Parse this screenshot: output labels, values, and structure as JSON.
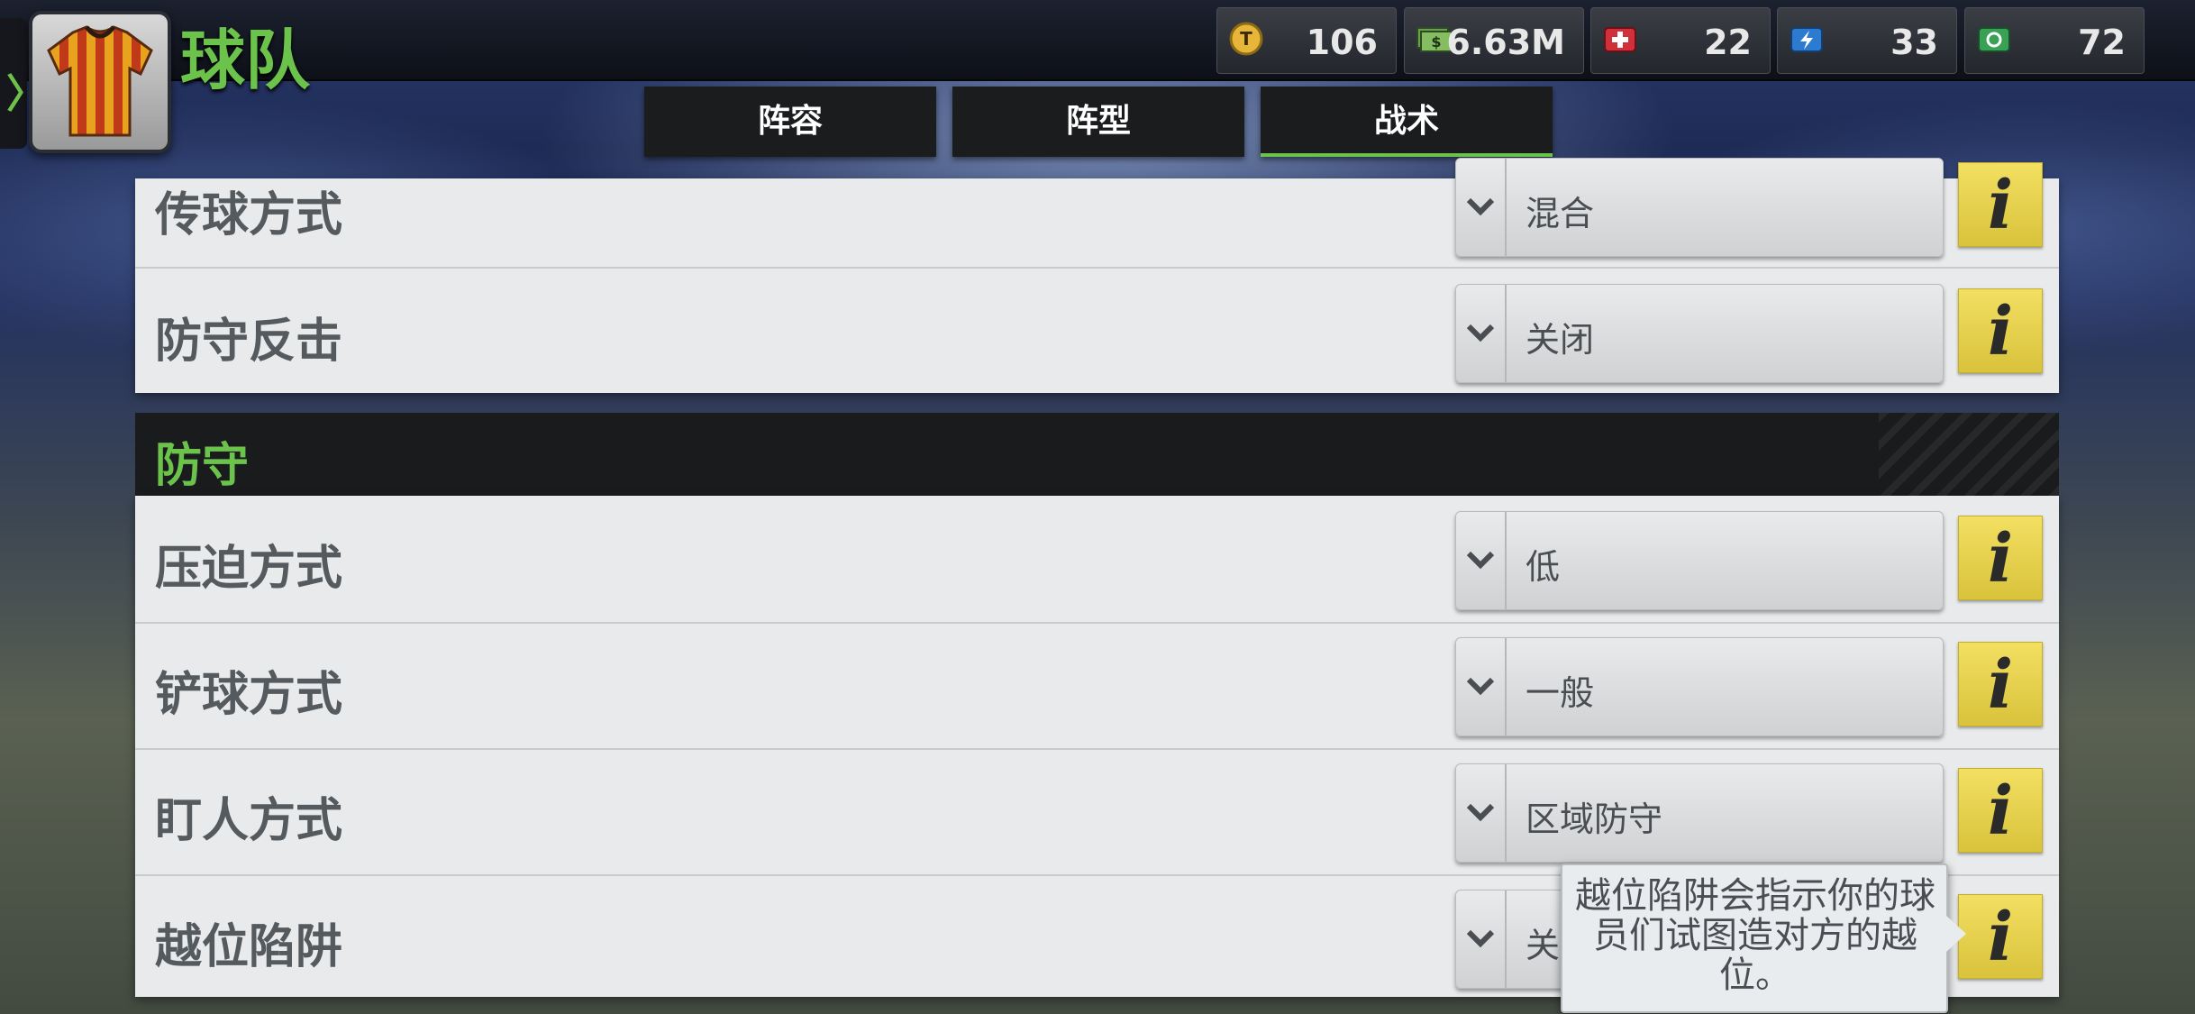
{
  "header": {
    "title": "球队"
  },
  "currencies": [
    {
      "icon": "token-coin-icon",
      "value": "106"
    },
    {
      "icon": "cash-icon",
      "value": "6.63M"
    },
    {
      "icon": "medical-kit-icon",
      "value": "22"
    },
    {
      "icon": "energy-bolt-icon",
      "value": "33"
    },
    {
      "icon": "money-icon",
      "value": "72"
    }
  ],
  "tabs": [
    {
      "label": "阵容",
      "active": false
    },
    {
      "label": "阵型",
      "active": false
    },
    {
      "label": "战术",
      "active": true
    }
  ],
  "attack_rows": [
    {
      "label": "传球方式",
      "value": "混合"
    },
    {
      "label": "防守反击",
      "value": "关闭"
    }
  ],
  "defense": {
    "title": "防守",
    "rows": [
      {
        "label": "压迫方式",
        "value": "低"
      },
      {
        "label": "铲球方式",
        "value": "一般"
      },
      {
        "label": "盯人方式",
        "value": "区域防守"
      },
      {
        "label": "越位陷阱",
        "value": "关"
      }
    ]
  },
  "tooltip": {
    "text": "越位陷阱会指示你的球员们试图造对方的越位。"
  },
  "colors": {
    "accent_green": "#6cc34b",
    "info_yellow": "#e8d24c"
  }
}
